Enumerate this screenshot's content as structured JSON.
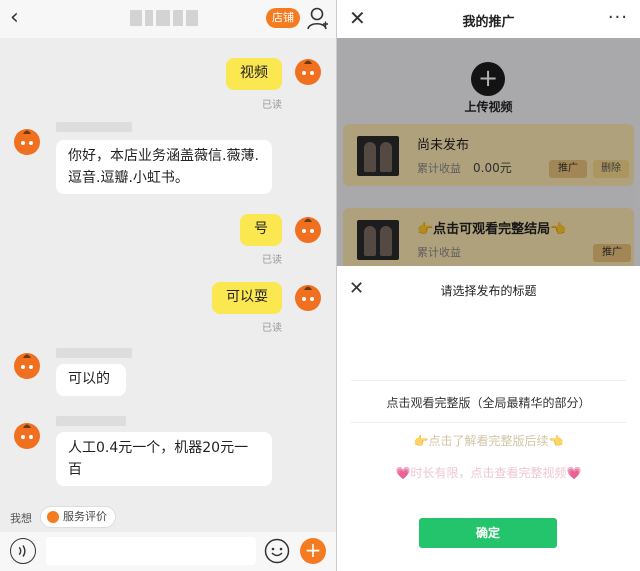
{
  "chat": {
    "shop_button": "店铺",
    "messages": [
      {
        "side": "me",
        "text": "视频",
        "status": "已读"
      },
      {
        "side": "other",
        "text": "你好，本店业务涵盖薇信.薇薄.逗音.逗瓣.小虹书。"
      },
      {
        "side": "me",
        "text": "号",
        "status": "已读"
      },
      {
        "side": "me",
        "text": "可以耍",
        "status": "已读"
      },
      {
        "side": "other",
        "text": "可以的"
      },
      {
        "side": "other",
        "text": "人工0.4元一个，机器20元一百"
      }
    ],
    "quick_prefix": "我想",
    "service_button": "服务评价"
  },
  "promo": {
    "title": "我的推广",
    "more": "···",
    "upload_label": "上传视频",
    "cards": [
      {
        "title": "尚未发布",
        "earnings_label": "累计收益",
        "earnings_value": "0.00元",
        "promote": "推广",
        "delete": "删除"
      },
      {
        "title": "👉点击可观看完整结局👈",
        "earnings_label": "累计收益",
        "promote": "推广"
      }
    ],
    "sheet": {
      "title": "请选择发布的标题",
      "options": [
        "点击观看完整版（全局最精华的部分）",
        "👉点击了解看完整版后续👈",
        "💗时长有限，点击查看完整视频💗"
      ],
      "confirm": "确定"
    }
  }
}
